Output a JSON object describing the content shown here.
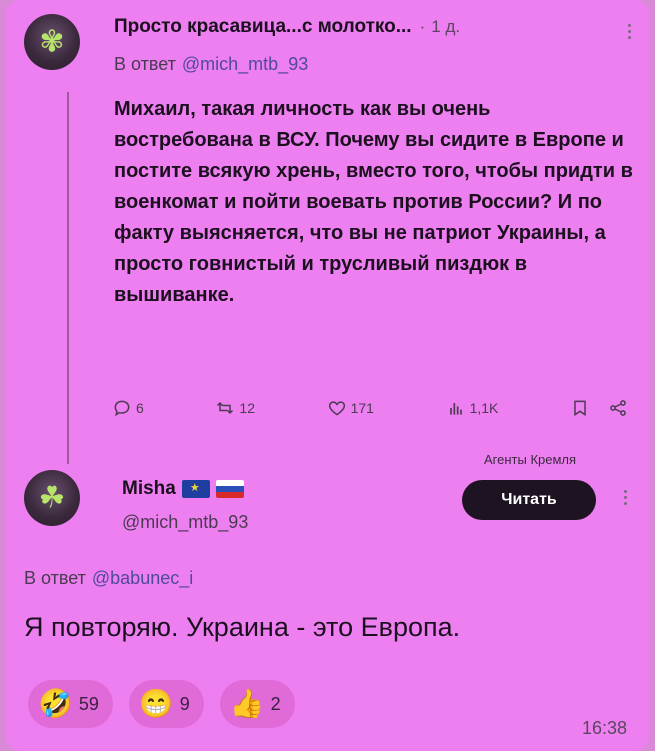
{
  "tweet": {
    "author_name": "Просто красавица...с молотко...",
    "separator": "·",
    "age": "1 д.",
    "reply_prefix": "В ответ",
    "reply_handle": "@mich_mtb_93",
    "text": "Михаил, такая личность как вы очень востребована в ВСУ. Почему вы сидите в Европе и постите всякую хрень, вместо того, чтобы придти в военкомат и пойти воевать против России? И по факту выясняется, что вы не патриот Украины, а просто говнистый и трусливый пиздюк в вышиванке.",
    "actions": {
      "replies": "6",
      "retweets": "12",
      "likes": "171",
      "views": "1,1K"
    }
  },
  "profile_card": {
    "promo_label": "Агенты Кремля",
    "name": "Misha",
    "handle": "@mich_mtb_93",
    "read_button": "Читать"
  },
  "message": {
    "reply_prefix": "В ответ",
    "reply_handle": "@babunec_i",
    "text": "Я повторяю. Украина - это Европа.",
    "time": "16:38",
    "reactions": [
      {
        "emoji": "🤣",
        "count": "59"
      },
      {
        "emoji": "😁",
        "count": "9"
      },
      {
        "emoji": "👍",
        "count": "2"
      }
    ]
  },
  "colors": {
    "background": "#ee7ff0",
    "button": "#1e1320",
    "link": "#4f4a9a"
  }
}
